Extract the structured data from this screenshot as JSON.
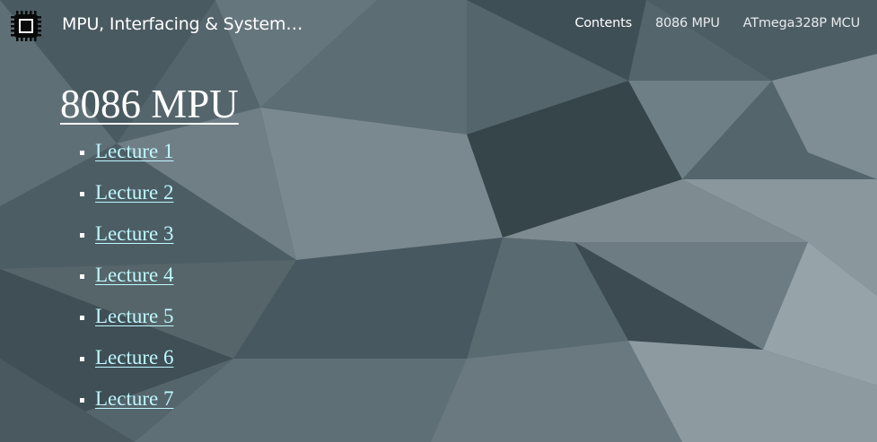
{
  "navbar": {
    "brand_icon": "chip-icon",
    "brand_title": "MPU, Interfacing & System De...",
    "links": [
      {
        "label": "Contents",
        "active": true
      },
      {
        "label": "8086 MPU",
        "active": false
      },
      {
        "label": "ATmega328P MCU",
        "active": false
      }
    ]
  },
  "main": {
    "title": "8086 MPU",
    "lectures": [
      {
        "label": "Lecture 1"
      },
      {
        "label": "Lecture 2"
      },
      {
        "label": "Lecture 3"
      },
      {
        "label": "Lecture 4"
      },
      {
        "label": "Lecture 5"
      },
      {
        "label": "Lecture 6"
      },
      {
        "label": "Lecture 7"
      }
    ]
  },
  "colors": {
    "link": "#bff7ff",
    "background": "#56666d",
    "text": "#ffffff"
  }
}
